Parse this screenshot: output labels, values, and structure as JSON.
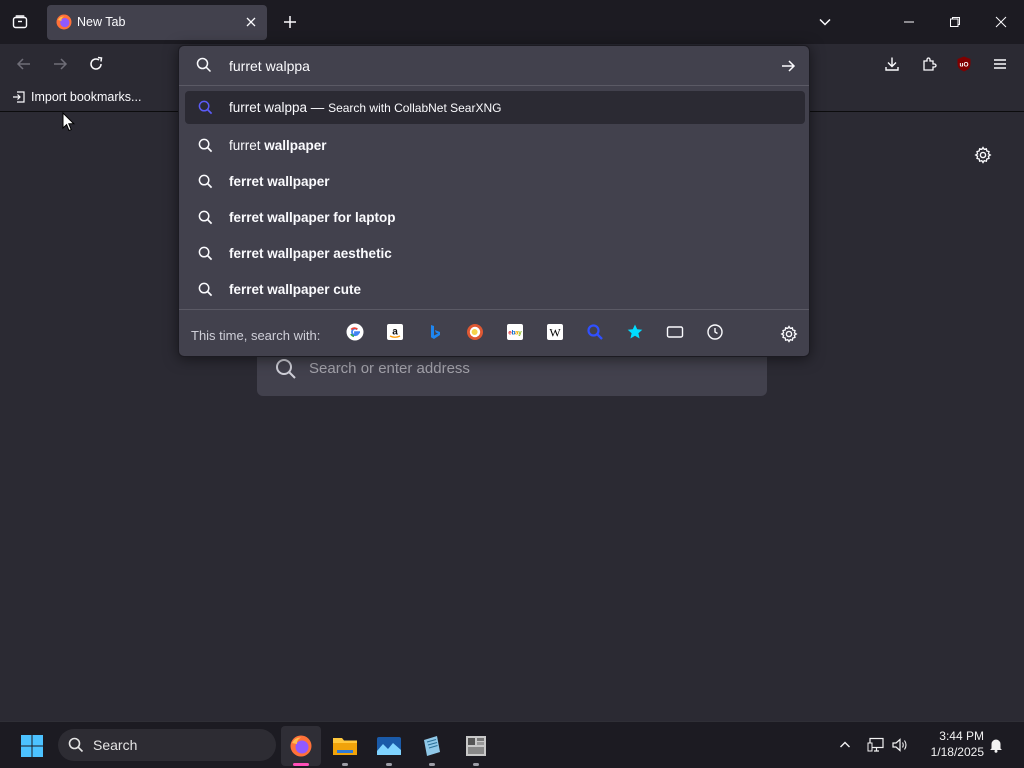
{
  "browser": {
    "tab": {
      "title": "New Tab"
    },
    "bookmarks": {
      "import_label": "Import bookmarks..."
    }
  },
  "urlbar": {
    "value": "furret walppa",
    "results": [
      {
        "prefix": "furret walppa",
        "bold": "",
        "suffix": " — ",
        "action": "Search with CollabNet SearXNG",
        "selected": true
      },
      {
        "prefix": "furret ",
        "bold": "wallpaper",
        "suffix": "",
        "action": "",
        "selected": false
      },
      {
        "prefix": "",
        "bold": "ferret wallpaper",
        "suffix": "",
        "action": "",
        "selected": false
      },
      {
        "prefix": "",
        "bold": "ferret wallpaper for laptop",
        "suffix": "",
        "action": "",
        "selected": false
      },
      {
        "prefix": "",
        "bold": "ferret wallpaper aesthetic",
        "suffix": "",
        "action": "",
        "selected": false
      },
      {
        "prefix": "",
        "bold": "ferret wallpaper cute",
        "suffix": "",
        "action": "",
        "selected": false
      }
    ],
    "oneoff_label": "This time, search with:",
    "engines": [
      "google",
      "amazon",
      "bing",
      "duckduckgo",
      "ebay",
      "wikipedia",
      "searxng",
      "bookmarks",
      "tabs",
      "history"
    ]
  },
  "newtab": {
    "search_placeholder": "Search or enter address"
  },
  "taskbar": {
    "search_label": "Search",
    "time": "3:44 PM",
    "date": "1/18/2025"
  },
  "colors": {
    "accent": "#0061e0",
    "selected_search_icon": "#5b5bf7"
  }
}
